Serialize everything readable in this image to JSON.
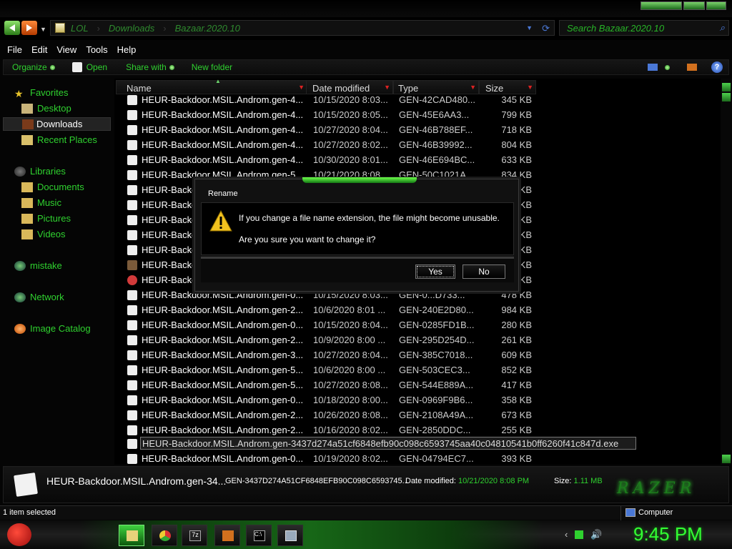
{
  "address": {
    "crumbs": [
      "LOL",
      "Downloads",
      "Bazaar.2020.10"
    ],
    "search_placeholder": "Search Bazaar.2020.10"
  },
  "menu": [
    "File",
    "Edit",
    "View",
    "Tools",
    "Help"
  ],
  "toolbar": {
    "organize": "Organize",
    "open": "Open",
    "share": "Share with",
    "new_folder": "New folder"
  },
  "sidebar": [
    {
      "label": "Favorites",
      "icon": "star-icon"
    },
    {
      "label": "Desktop",
      "icon": "desktop-icon"
    },
    {
      "label": "Downloads",
      "icon": "downloads-icon",
      "selected": true
    },
    {
      "label": "Recent Places",
      "icon": "recent-places-icon"
    },
    {
      "label": "Libraries",
      "icon": "libraries-icon"
    },
    {
      "label": "Documents",
      "icon": "documents-icon"
    },
    {
      "label": "Music",
      "icon": "music-icon"
    },
    {
      "label": "Pictures",
      "icon": "pictures-icon"
    },
    {
      "label": "Videos",
      "icon": "videos-icon"
    },
    {
      "label": "mistake",
      "icon": "homegroup-icon"
    },
    {
      "label": "Network",
      "icon": "network-icon"
    },
    {
      "label": "Image Catalog",
      "icon": "image-catalog-icon"
    }
  ],
  "columns": {
    "name": "Name",
    "date": "Date modified",
    "type": "Type",
    "size": "Size"
  },
  "files": [
    {
      "name": "HEUR-Backdoor.MSIL.Androm.gen-4...",
      "date": "10/15/2020 8:03...",
      "type": "GEN-42CAD480...",
      "size": "345 KB"
    },
    {
      "name": "HEUR-Backdoor.MSIL.Androm.gen-4...",
      "date": "10/15/2020 8:05...",
      "type": "GEN-45E6AA3...",
      "size": "799 KB"
    },
    {
      "name": "HEUR-Backdoor.MSIL.Androm.gen-4...",
      "date": "10/27/2020 8:04...",
      "type": "GEN-46B788EF...",
      "size": "718 KB"
    },
    {
      "name": "HEUR-Backdoor.MSIL.Androm.gen-4...",
      "date": "10/27/2020 8:02...",
      "type": "GEN-46B39992...",
      "size": "804 KB"
    },
    {
      "name": "HEUR-Backdoor.MSIL.Androm.gen-4...",
      "date": "10/30/2020 8:01...",
      "type": "GEN-46E694BC...",
      "size": "633 KB"
    },
    {
      "name": "HEUR-Backdoor.MSIL.Androm.gen-5...",
      "date": "10/21/2020 8:08...",
      "type": "GEN-50C1021A...",
      "size": "834 KB"
    },
    {
      "name": "HEUR-Backdo",
      "date": "",
      "type": "",
      "size": "KB"
    },
    {
      "name": "HEUR-Backdo",
      "date": "",
      "type": "",
      "size": "KB"
    },
    {
      "name": "HEUR-Backdo",
      "date": "",
      "type": "",
      "size": "KB"
    },
    {
      "name": "HEUR-Backdo",
      "date": "",
      "type": "",
      "size": "KB"
    },
    {
      "name": "HEUR-Backdo",
      "date": "",
      "type": "",
      "size": "KB"
    },
    {
      "name": "HEUR-Backdo",
      "date": "",
      "type": "",
      "size": "KB"
    },
    {
      "name": "HEUR-Backdo",
      "date": "",
      "type": "",
      "size": "KB"
    },
    {
      "name": "HEUR-Backdoor.MSIL.Androm.gen-0...",
      "date": "10/15/2020 8:03...",
      "type": "GEN-0...D733...",
      "size": "478 KB"
    },
    {
      "name": "HEUR-Backdoor.MSIL.Androm.gen-2...",
      "date": "10/6/2020 8:01 ...",
      "type": "GEN-240E2D80...",
      "size": "984 KB"
    },
    {
      "name": "HEUR-Backdoor.MSIL.Androm.gen-0...",
      "date": "10/15/2020 8:04...",
      "type": "GEN-0285FD1B...",
      "size": "280 KB"
    },
    {
      "name": "HEUR-Backdoor.MSIL.Androm.gen-2...",
      "date": "10/9/2020 8:00 ...",
      "type": "GEN-295D254D...",
      "size": "261 KB"
    },
    {
      "name": "HEUR-Backdoor.MSIL.Androm.gen-3...",
      "date": "10/27/2020 8:04...",
      "type": "GEN-385C7018...",
      "size": "609 KB"
    },
    {
      "name": "HEUR-Backdoor.MSIL.Androm.gen-5...",
      "date": "10/6/2020 8:00 ...",
      "type": "GEN-503CEC3...",
      "size": "852 KB"
    },
    {
      "name": "HEUR-Backdoor.MSIL.Androm.gen-5...",
      "date": "10/27/2020 8:08...",
      "type": "GEN-544E889A...",
      "size": "417 KB"
    },
    {
      "name": "HEUR-Backdoor.MSIL.Androm.gen-0...",
      "date": "10/18/2020 8:00...",
      "type": "GEN-0969F9B6...",
      "size": "358 KB"
    },
    {
      "name": "HEUR-Backdoor.MSIL.Androm.gen-2...",
      "date": "10/26/2020 8:08...",
      "type": "GEN-2108A49A...",
      "size": "673 KB"
    },
    {
      "name": "HEUR-Backdoor.MSIL.Androm.gen-2...",
      "date": "10/16/2020 8:02...",
      "type": "GEN-2850DDC...",
      "size": "255 KB"
    },
    {
      "name": "HEUR-Backdoor.MSIL.Androm.gen-3437d274a51cf6848efb90c098c6593745aa40c04810541b0ff6260f41c847d.exe",
      "date": "",
      "type": "",
      "size": "",
      "renaming": true
    },
    {
      "name": "HEUR-Backdoor.MSIL.Androm.gen-0...",
      "date": "10/19/2020 8:02...",
      "type": "GEN-04794EC7...",
      "size": "393 KB"
    }
  ],
  "dialog": {
    "title": "Rename",
    "message1": "If you change a file name extension, the file might become unusable.",
    "message2": "Are you sure you want to change it?",
    "yes": "Yes",
    "no": "No"
  },
  "details": {
    "name": "HEUR-Backdoor.MSIL.Androm.gen-34...",
    "type": "GEN-3437D274A51CF6848EFB90C098C6593745...",
    "date_label": "Date modified:",
    "date_value": "10/21/2020 8:08 PM",
    "size_label": "Size:",
    "size_value": "1.11 MB",
    "logo": "RAZER"
  },
  "status": {
    "left": "1 item selected",
    "right": "Computer"
  },
  "clock": "9:45 PM",
  "colors": {
    "accent": "#2fd12f",
    "background": "#000000"
  }
}
